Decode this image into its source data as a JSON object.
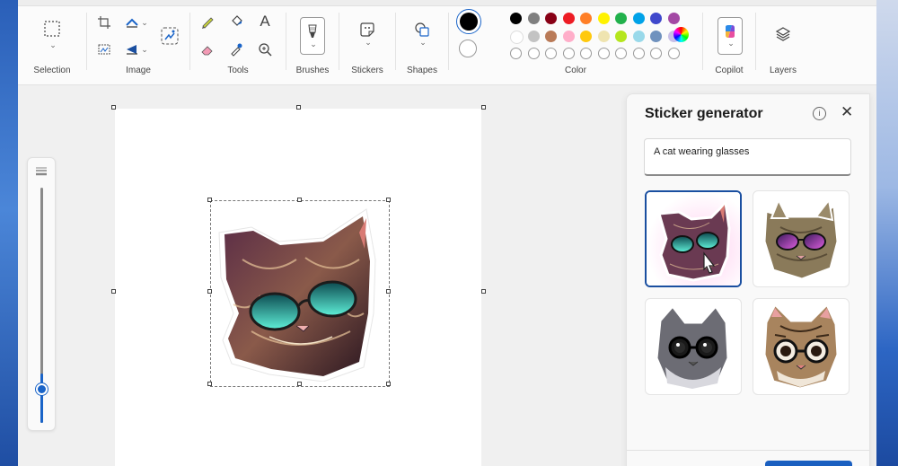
{
  "ribbon": {
    "groups": {
      "selection": "Selection",
      "image": "Image",
      "tools": "Tools",
      "brushes": "Brushes",
      "stickers": "Stickers",
      "shapes": "Shapes",
      "color": "Color",
      "copilot": "Copilot",
      "layers": "Layers"
    },
    "text_tool_glyph": "A"
  },
  "colors": {
    "primary": "#000000",
    "secondary": "#ffffff",
    "row1": [
      "#000000",
      "#7f7f7f",
      "#880015",
      "#ed1c24",
      "#ff7f27",
      "#fff200",
      "#22b14c",
      "#00a2e8",
      "#3f48cc",
      "#a349a4"
    ],
    "row2": [
      "#ffffff",
      "#c3c3c3",
      "#b97a57",
      "#ffaec9",
      "#ffc90e",
      "#efe4b0",
      "#b5e61d",
      "#99d9ea",
      "#7092be",
      "#c8bfe7"
    ],
    "row3_empty_count": 10
  },
  "panel": {
    "title": "Sticker generator",
    "info_glyph": "i",
    "close_glyph": "✕",
    "prompt_value": "A cat wearing glasses"
  },
  "stickers": [
    {
      "name": "sticker-option-1",
      "style": "sunglasses-cat-dark",
      "selected": true
    },
    {
      "name": "sticker-option-2",
      "style": "sunglasses-cat-tabby",
      "selected": false
    },
    {
      "name": "sticker-option-3",
      "style": "glasses-cat-grey",
      "selected": false
    },
    {
      "name": "sticker-option-4",
      "style": "glasses-cat-brown",
      "selected": false
    }
  ],
  "accent_color": "#1a64c8"
}
